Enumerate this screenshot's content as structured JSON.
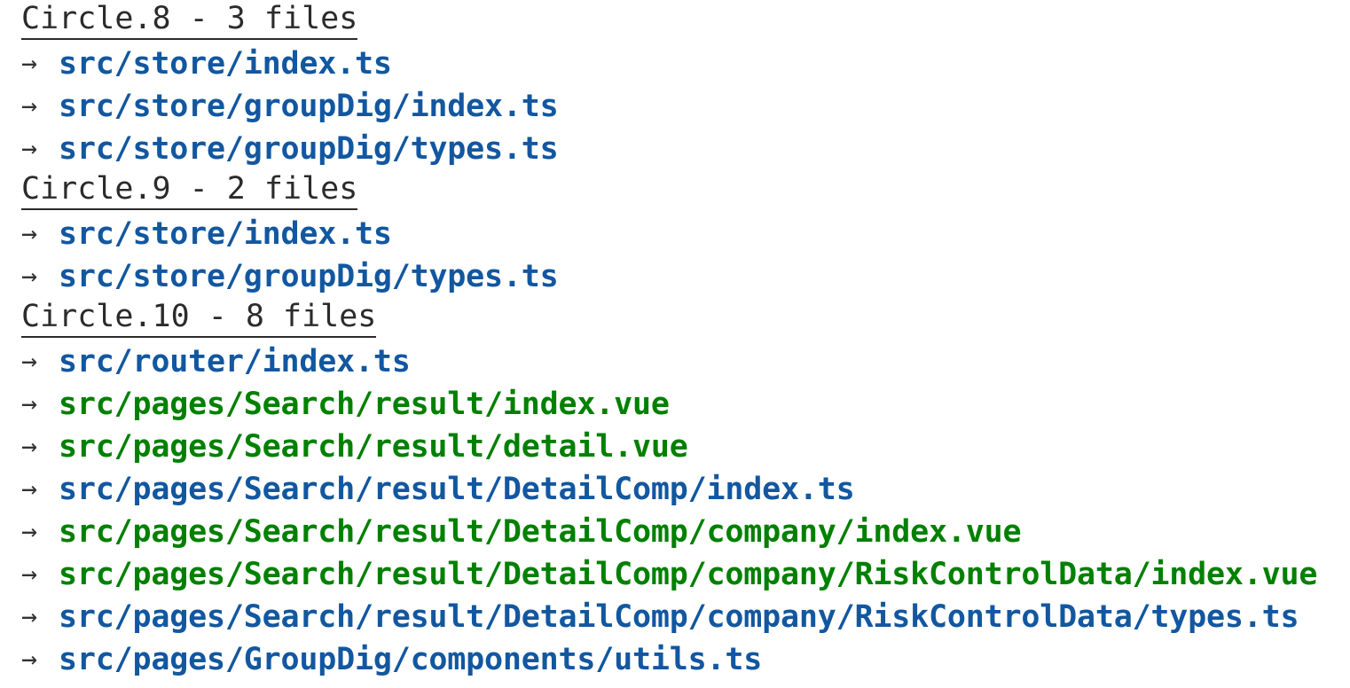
{
  "palette": {
    "background": "#ffffff",
    "header_text": "#2b2b2b",
    "arrow": "#333333",
    "ts_blue": "#1257a0",
    "vue_green": "#018000"
  },
  "icons": {
    "arrow": "→",
    "arrow_name": "arrow-right-icon"
  },
  "groups": [
    {
      "header": "Circle.8 - 3 files",
      "name": "Circle.8",
      "file_count": 3,
      "files": [
        {
          "path": "src/store/index.ts",
          "ext": "ts"
        },
        {
          "path": "src/store/groupDig/index.ts",
          "ext": "ts"
        },
        {
          "path": "src/store/groupDig/types.ts",
          "ext": "ts"
        }
      ]
    },
    {
      "header": "Circle.9 - 2 files",
      "name": "Circle.9",
      "file_count": 2,
      "files": [
        {
          "path": "src/store/index.ts",
          "ext": "ts"
        },
        {
          "path": "src/store/groupDig/types.ts",
          "ext": "ts"
        }
      ]
    },
    {
      "header": "Circle.10 - 8 files",
      "name": "Circle.10",
      "file_count": 8,
      "files": [
        {
          "path": "src/router/index.ts",
          "ext": "ts"
        },
        {
          "path": "src/pages/Search/result/index.vue",
          "ext": "vue"
        },
        {
          "path": "src/pages/Search/result/detail.vue",
          "ext": "vue"
        },
        {
          "path": "src/pages/Search/result/DetailComp/index.ts",
          "ext": "ts"
        },
        {
          "path": "src/pages/Search/result/DetailComp/company/index.vue",
          "ext": "vue"
        },
        {
          "path": "src/pages/Search/result/DetailComp/company/RiskControlData/index.vue",
          "ext": "vue"
        },
        {
          "path": "src/pages/Search/result/DetailComp/company/RiskControlData/types.ts",
          "ext": "ts"
        },
        {
          "path": "src/pages/GroupDig/components/utils.ts",
          "ext": "ts"
        }
      ]
    }
  ]
}
